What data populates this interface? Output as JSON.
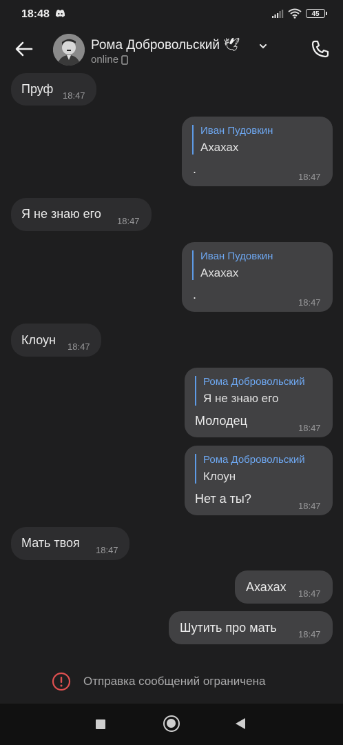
{
  "status_bar": {
    "time": "18:48",
    "battery": "45"
  },
  "header": {
    "name": "Рома Добровольский 🕊",
    "status": "online"
  },
  "messages": [
    {
      "dir": "in",
      "text": "Пруф",
      "time": "18:47"
    },
    {
      "dir": "out",
      "reply_name": "Иван Пудовкин",
      "reply_text": "Ахахах",
      "text": ".",
      "time": "18:47"
    },
    {
      "dir": "in",
      "text": "Я не знаю его",
      "time": "18:47"
    },
    {
      "dir": "out",
      "reply_name": "Иван Пудовкин",
      "reply_text": "Ахахах",
      "text": ".",
      "time": "18:47"
    },
    {
      "dir": "in",
      "text": "Клоун",
      "time": "18:47"
    },
    {
      "dir": "out",
      "reply_name": "Рома Добровольский",
      "reply_text": "Я не знаю его",
      "text": "Молодец",
      "time": "18:47"
    },
    {
      "dir": "out",
      "reply_name": "Рома Добровольский",
      "reply_text": "Клоун",
      "text": "Нет а ты?",
      "time": "18:47"
    },
    {
      "dir": "in",
      "text": "Мать твоя",
      "time": "18:47"
    },
    {
      "dir": "out",
      "text": "Ахахах",
      "time": "18:47"
    },
    {
      "dir": "out",
      "text": "Шутить про мать",
      "time": "18:47"
    }
  ],
  "restriction": {
    "label": "Отправка сообщений ограничена",
    "icon": "warning-circle-icon",
    "color": "#e05050"
  },
  "colors": {
    "accent": "#6ea8f2",
    "incoming": "#2d2d2f",
    "outgoing": "#414143",
    "background": "#1e1e1f"
  }
}
